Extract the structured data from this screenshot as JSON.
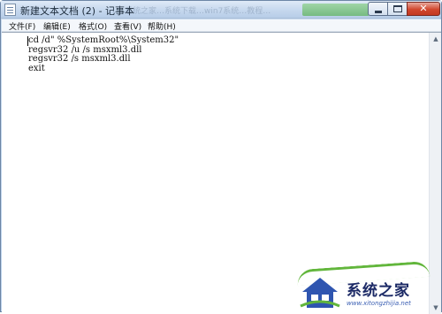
{
  "window": {
    "title": "新建文本文档 (2) - 记事本",
    "ghost_title": "系统之家…系统下载…win7系统…教程…",
    "controls": {
      "minimize": "minimize",
      "maximize": "maximize",
      "close": "x"
    }
  },
  "menu": {
    "items": [
      {
        "label": "文件(F)"
      },
      {
        "label": "编辑(E)"
      },
      {
        "label": "格式(O)"
      },
      {
        "label": "查看(V)"
      },
      {
        "label": "帮助(H)"
      }
    ]
  },
  "editor": {
    "lines": [
      "cd /d\" %SystemRoot%\\System32\"",
      "regsvr32 /u /s msxml3.dll",
      "regsvr32 /s msxml3.dll",
      "exit"
    ]
  },
  "watermark": {
    "title": "系统之家",
    "url": "www.xitongzhijia.net"
  },
  "colors": {
    "close_button": "#d1472e",
    "titlebar": "#c6d8ee",
    "watermark_green": "#62b63c",
    "watermark_blue": "#1c2a66"
  }
}
